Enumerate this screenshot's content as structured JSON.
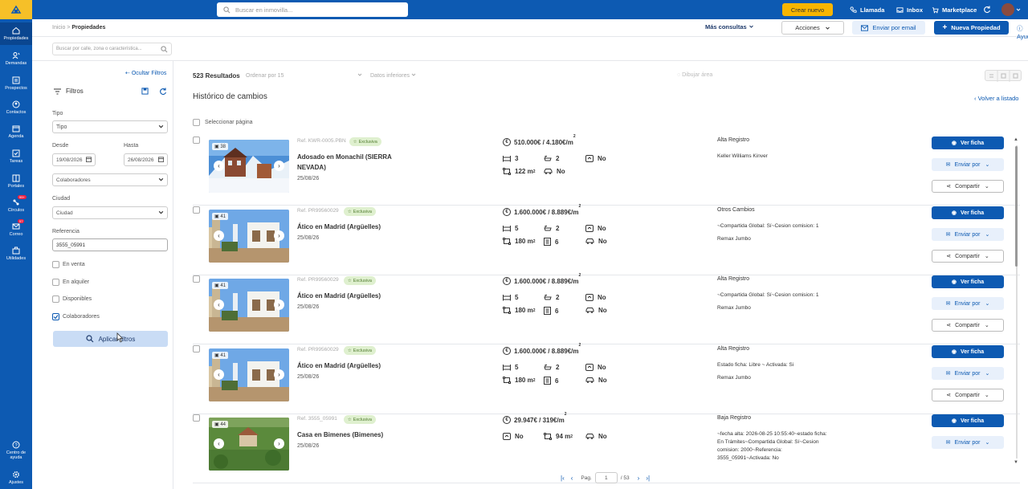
{
  "topbar": {
    "search_placeholder": "Buscar en inmovilla...",
    "create_label": "Crear nuevo",
    "call_label": "Llamada",
    "inbox_label": "Inbox",
    "marketplace_label": "Marketplace"
  },
  "sidebar": {
    "items": [
      {
        "label": "Propiedades",
        "icon": "home-icon"
      },
      {
        "label": "Demandas",
        "icon": "users-search-icon"
      },
      {
        "label": "Prospectos",
        "icon": "list-icon"
      },
      {
        "label": "Contactos",
        "icon": "contact-icon"
      },
      {
        "label": "Agenda",
        "icon": "calendar-icon"
      },
      {
        "label": "Tareas",
        "icon": "tasks-icon"
      },
      {
        "label": "Portales",
        "icon": "portals-icon"
      },
      {
        "label": "Círculos",
        "icon": "circles-icon",
        "badge": "99+"
      },
      {
        "label": "Correo",
        "icon": "mail-icon",
        "badge": "57"
      },
      {
        "label": "Utilidades",
        "icon": "briefcase-icon"
      }
    ],
    "help_label": "Centro de ayuda",
    "settings_label": "Ajustes"
  },
  "subheader": {
    "breadcrumb_root": "Inicio",
    "breadcrumb_sep": ">",
    "breadcrumb_current": "Propiedades",
    "more_label": "Más consultas",
    "actions_label": "Acciones",
    "email_label": "Enviar por email",
    "new_label": "Nueva Propiedad",
    "help_label": "Ayuda"
  },
  "address_search_placeholder": "Buscar por calle, zona o característica...",
  "filters": {
    "hide_label": "Ocultar Filtros",
    "title": "Filtros",
    "tipo_label": "Tipo",
    "tipo_value": "Tipo",
    "desde_label": "Desde",
    "desde_value": "19/08/2026",
    "hasta_label": "Hasta",
    "hasta_value": "26/08/2026",
    "colaboradores_value": "Colaboradores",
    "ciudad_label": "Ciudad",
    "ciudad_value": "Ciudad",
    "referencia_label": "Referencia",
    "referencia_value": "3555_05991",
    "checks": [
      {
        "label": "En venta",
        "checked": false
      },
      {
        "label": "En alquiler",
        "checked": false
      },
      {
        "label": "Disponibles",
        "checked": false
      },
      {
        "label": "Colaboradores",
        "checked": true
      }
    ],
    "apply_label": "Aplicar filtros"
  },
  "main": {
    "results": "523 Resultados",
    "order_label": "Ordenar por 15",
    "datos_label": "Datos inferiores",
    "draw_label": "Dibujar área",
    "section_title": "Histórico de cambios",
    "back_label": "Volver a listado",
    "select_page_label": "Seleccionar página"
  },
  "listings": [
    {
      "ref": "Ref. KWR-0005.PBN",
      "badge": "Exclusiva",
      "title": "Adosado en Monachil (SIERRA NEVADA)",
      "date": "25/08/26",
      "photos": "38",
      "price": "510.000€ / 4.180€/m",
      "price_sup": "2",
      "specs": [
        [
          "bed-icon",
          "3"
        ],
        [
          "bath-icon",
          "2"
        ],
        [
          "lift-icon",
          "No"
        ],
        [
          "area-icon",
          "122 m",
          "2"
        ],
        [
          "car-icon",
          "No"
        ]
      ],
      "history_title": "Alta Registro",
      "history_lines": [
        "Keller Williams Kinver"
      ],
      "img_theme": "snow"
    },
    {
      "ref": "Ref. PR99560029",
      "badge": "Exclusiva",
      "title": "Ático en Madrid (Argüelles)",
      "date": "25/08/26",
      "photos": "41",
      "price": "1.600.000€ / 8.889€/m",
      "price_sup": "2",
      "specs": [
        [
          "bed-icon",
          "5"
        ],
        [
          "bath-icon",
          "2"
        ],
        [
          "lift-icon",
          "No"
        ],
        [
          "area-icon",
          "180 m",
          "2"
        ],
        [
          "floor-icon",
          "6"
        ],
        [
          "car-icon",
          "No"
        ]
      ],
      "history_title": "Otros Cambios",
      "history_lines": [
        "~Compartida Global: Sí~Cesion comision: 1",
        "Remax Jumbo"
      ],
      "img_theme": "city"
    },
    {
      "ref": "Ref. PR99560029",
      "badge": "Exclusiva",
      "title": "Ático en Madrid (Argüelles)",
      "date": "25/08/26",
      "photos": "41",
      "price": "1.600.000€ / 8.889€/m",
      "price_sup": "2",
      "specs": [
        [
          "bed-icon",
          "5"
        ],
        [
          "bath-icon",
          "2"
        ],
        [
          "lift-icon",
          "No"
        ],
        [
          "area-icon",
          "180 m",
          "2"
        ],
        [
          "floor-icon",
          "6"
        ],
        [
          "car-icon",
          "No"
        ]
      ],
      "history_title": "Alta Registro",
      "history_lines": [
        "~Compartida Global: Sí~Cesion comision: 1",
        "Remax Jumbo"
      ],
      "img_theme": "city"
    },
    {
      "ref": "Ref. PR99560029",
      "badge": "Exclusiva",
      "title": "Ático en Madrid (Argüelles)",
      "date": "25/08/26",
      "photos": "41",
      "price": "1.600.000€ / 8.889€/m",
      "price_sup": "2",
      "specs": [
        [
          "bed-icon",
          "5"
        ],
        [
          "bath-icon",
          "2"
        ],
        [
          "lift-icon",
          "No"
        ],
        [
          "area-icon",
          "180 m",
          "2"
        ],
        [
          "floor-icon",
          "6"
        ],
        [
          "car-icon",
          "No"
        ]
      ],
      "history_title": "Alta Registro",
      "history_lines": [
        "Estado ficha: Libre ~ Activada: Si",
        "Remax Jumbo"
      ],
      "img_theme": "city"
    },
    {
      "ref": "Ref. 3555_05991",
      "badge": "Exclusiva",
      "title": "Casa en Bimenes (Bimenes)",
      "date": "25/08/26",
      "photos": "44",
      "price": "29.947€ / 319€/m",
      "price_sup": "2",
      "specs": [
        [
          "lift-icon",
          "No"
        ],
        [
          "area-icon",
          "94 m",
          "2"
        ],
        [
          "car-icon",
          "No"
        ]
      ],
      "history_title": "Baja Registro",
      "history_lines": [
        "~fecha alta: 2026-08-25 10:55:40~estado ficha:",
        "En Trámites~Compartida Global: Sí~Cesion",
        "comision: 2000~Referencia:",
        "3555_05991~Activada: No"
      ],
      "img_theme": "green"
    }
  ],
  "row_buttons": {
    "view": "Ver ficha",
    "send": "Enviar por",
    "share": "Compartir"
  },
  "pagination": {
    "page_label": "Pag.",
    "current": "1",
    "total": "/ 53"
  },
  "colors": {
    "primary": "#0d5ab2",
    "accent": "#f7b500",
    "badge_bg": "#dff0cf"
  }
}
